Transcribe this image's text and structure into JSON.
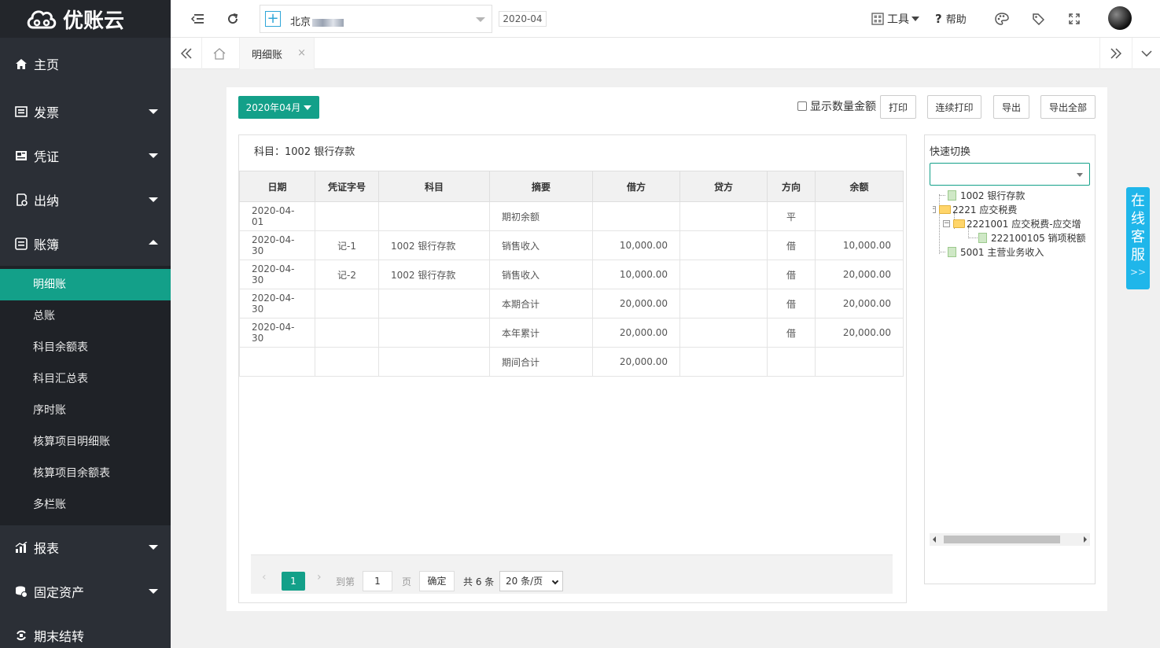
{
  "app": {
    "logo_text": "优账云"
  },
  "sidebar": {
    "items": [
      {
        "label": "主页",
        "icon": "home-icon"
      },
      {
        "label": "发票",
        "icon": "invoice-icon"
      },
      {
        "label": "凭证",
        "icon": "voucher-icon"
      },
      {
        "label": "出纳",
        "icon": "cashier-icon"
      },
      {
        "label": "账簿",
        "icon": "ledger-icon"
      },
      {
        "label": "报表",
        "icon": "report-icon"
      },
      {
        "label": "固定资产",
        "icon": "asset-icon"
      },
      {
        "label": "期末结转",
        "icon": "closing-icon"
      }
    ],
    "ledger_submenu": [
      "明细账",
      "总账",
      "科目余额表",
      "科目汇总表",
      "序时账",
      "核算项目明细账",
      "核算项目余额表",
      "多栏账"
    ],
    "active_sub": "明细账"
  },
  "header": {
    "company_name": "北京",
    "period": "2020-04",
    "tools_label": "工具",
    "help_label": "帮助"
  },
  "tabs": {
    "active_label": "明细账",
    "close_glyph": "×"
  },
  "toolbar": {
    "period_button": "2020年04月",
    "show_qty_label": "显示数量金额",
    "print": "打印",
    "continuous_print": "连续打印",
    "export": "导出",
    "export_all": "导出全部"
  },
  "ledger": {
    "subject_line": "科目：1002 银行存款",
    "columns": [
      "日期",
      "凭证字号",
      "科目",
      "摘要",
      "借方",
      "贷方",
      "方向",
      "余额"
    ],
    "rows": [
      [
        "2020-04-01",
        "",
        "",
        "期初余额",
        "",
        "",
        "平",
        ""
      ],
      [
        "2020-04-30",
        "记-1",
        "1002 银行存款",
        "销售收入",
        "10,000.00",
        "",
        "借",
        "10,000.00"
      ],
      [
        "2020-04-30",
        "记-2",
        "1002 银行存款",
        "销售收入",
        "10,000.00",
        "",
        "借",
        "20,000.00"
      ],
      [
        "2020-04-30",
        "",
        "",
        "本期合计",
        "20,000.00",
        "",
        "借",
        "20,000.00"
      ],
      [
        "2020-04-30",
        "",
        "",
        "本年累计",
        "20,000.00",
        "",
        "借",
        "20,000.00"
      ],
      [
        "",
        "",
        "",
        "期间合计",
        "20,000.00",
        "",
        "",
        ""
      ]
    ]
  },
  "pager": {
    "prev": "‹",
    "current": "1",
    "next": "›",
    "goto_label": "到第",
    "goto_value": "1",
    "page_unit": "页",
    "confirm": "确定",
    "total": "共 6 条",
    "page_size": "20 条/页"
  },
  "quick_switch": {
    "title": "快速切换",
    "tree": [
      {
        "label": "1002 银行存款"
      },
      {
        "label": "2221 应交税费"
      },
      {
        "label": "2221001 应交税费-应交增"
      },
      {
        "label": "222100105 销项税额"
      },
      {
        "label": "5001 主营业务收入"
      }
    ]
  },
  "service": {
    "chars": [
      "在",
      "线",
      "客",
      "服"
    ],
    "arrows": ">>"
  },
  "colors": {
    "accent": "#13a089",
    "sidebar": "#2b2f36",
    "service": "#1fb6ea"
  }
}
